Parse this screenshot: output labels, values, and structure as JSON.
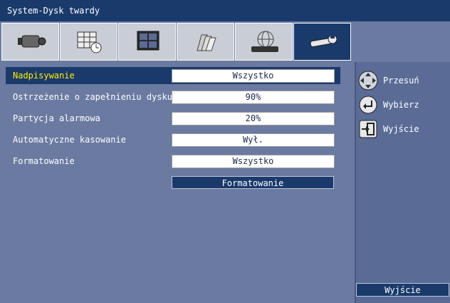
{
  "window": {
    "title": "System-Dysk twardy"
  },
  "tabs": [
    {
      "icon": "camera-icon"
    },
    {
      "icon": "schedule-icon"
    },
    {
      "icon": "monitor-icon"
    },
    {
      "icon": "archive-icon"
    },
    {
      "icon": "network-icon"
    },
    {
      "icon": "tools-icon",
      "active": true
    }
  ],
  "settings": [
    {
      "label": "Nadpisywanie",
      "value": "Wszystko",
      "selected": true
    },
    {
      "label": "Ostrzeżenie o zapełnieniu dysku",
      "value": "90%"
    },
    {
      "label": "Partycja alarmowa",
      "value": "20%"
    },
    {
      "label": "Automatyczne kasowanie",
      "value": "Wył."
    },
    {
      "label": "Formatowanie",
      "value": "Wszystko"
    }
  ],
  "format_button": "Formatowanie",
  "legend": {
    "move": "Przesuń",
    "select": "Wybierz",
    "exit": "Wyjście"
  },
  "exit_button": "Wyjście",
  "colors": {
    "title_bg": "#1a3a6b",
    "selected_label": "#ffee00",
    "panel_bg": "#6b7aa1"
  }
}
